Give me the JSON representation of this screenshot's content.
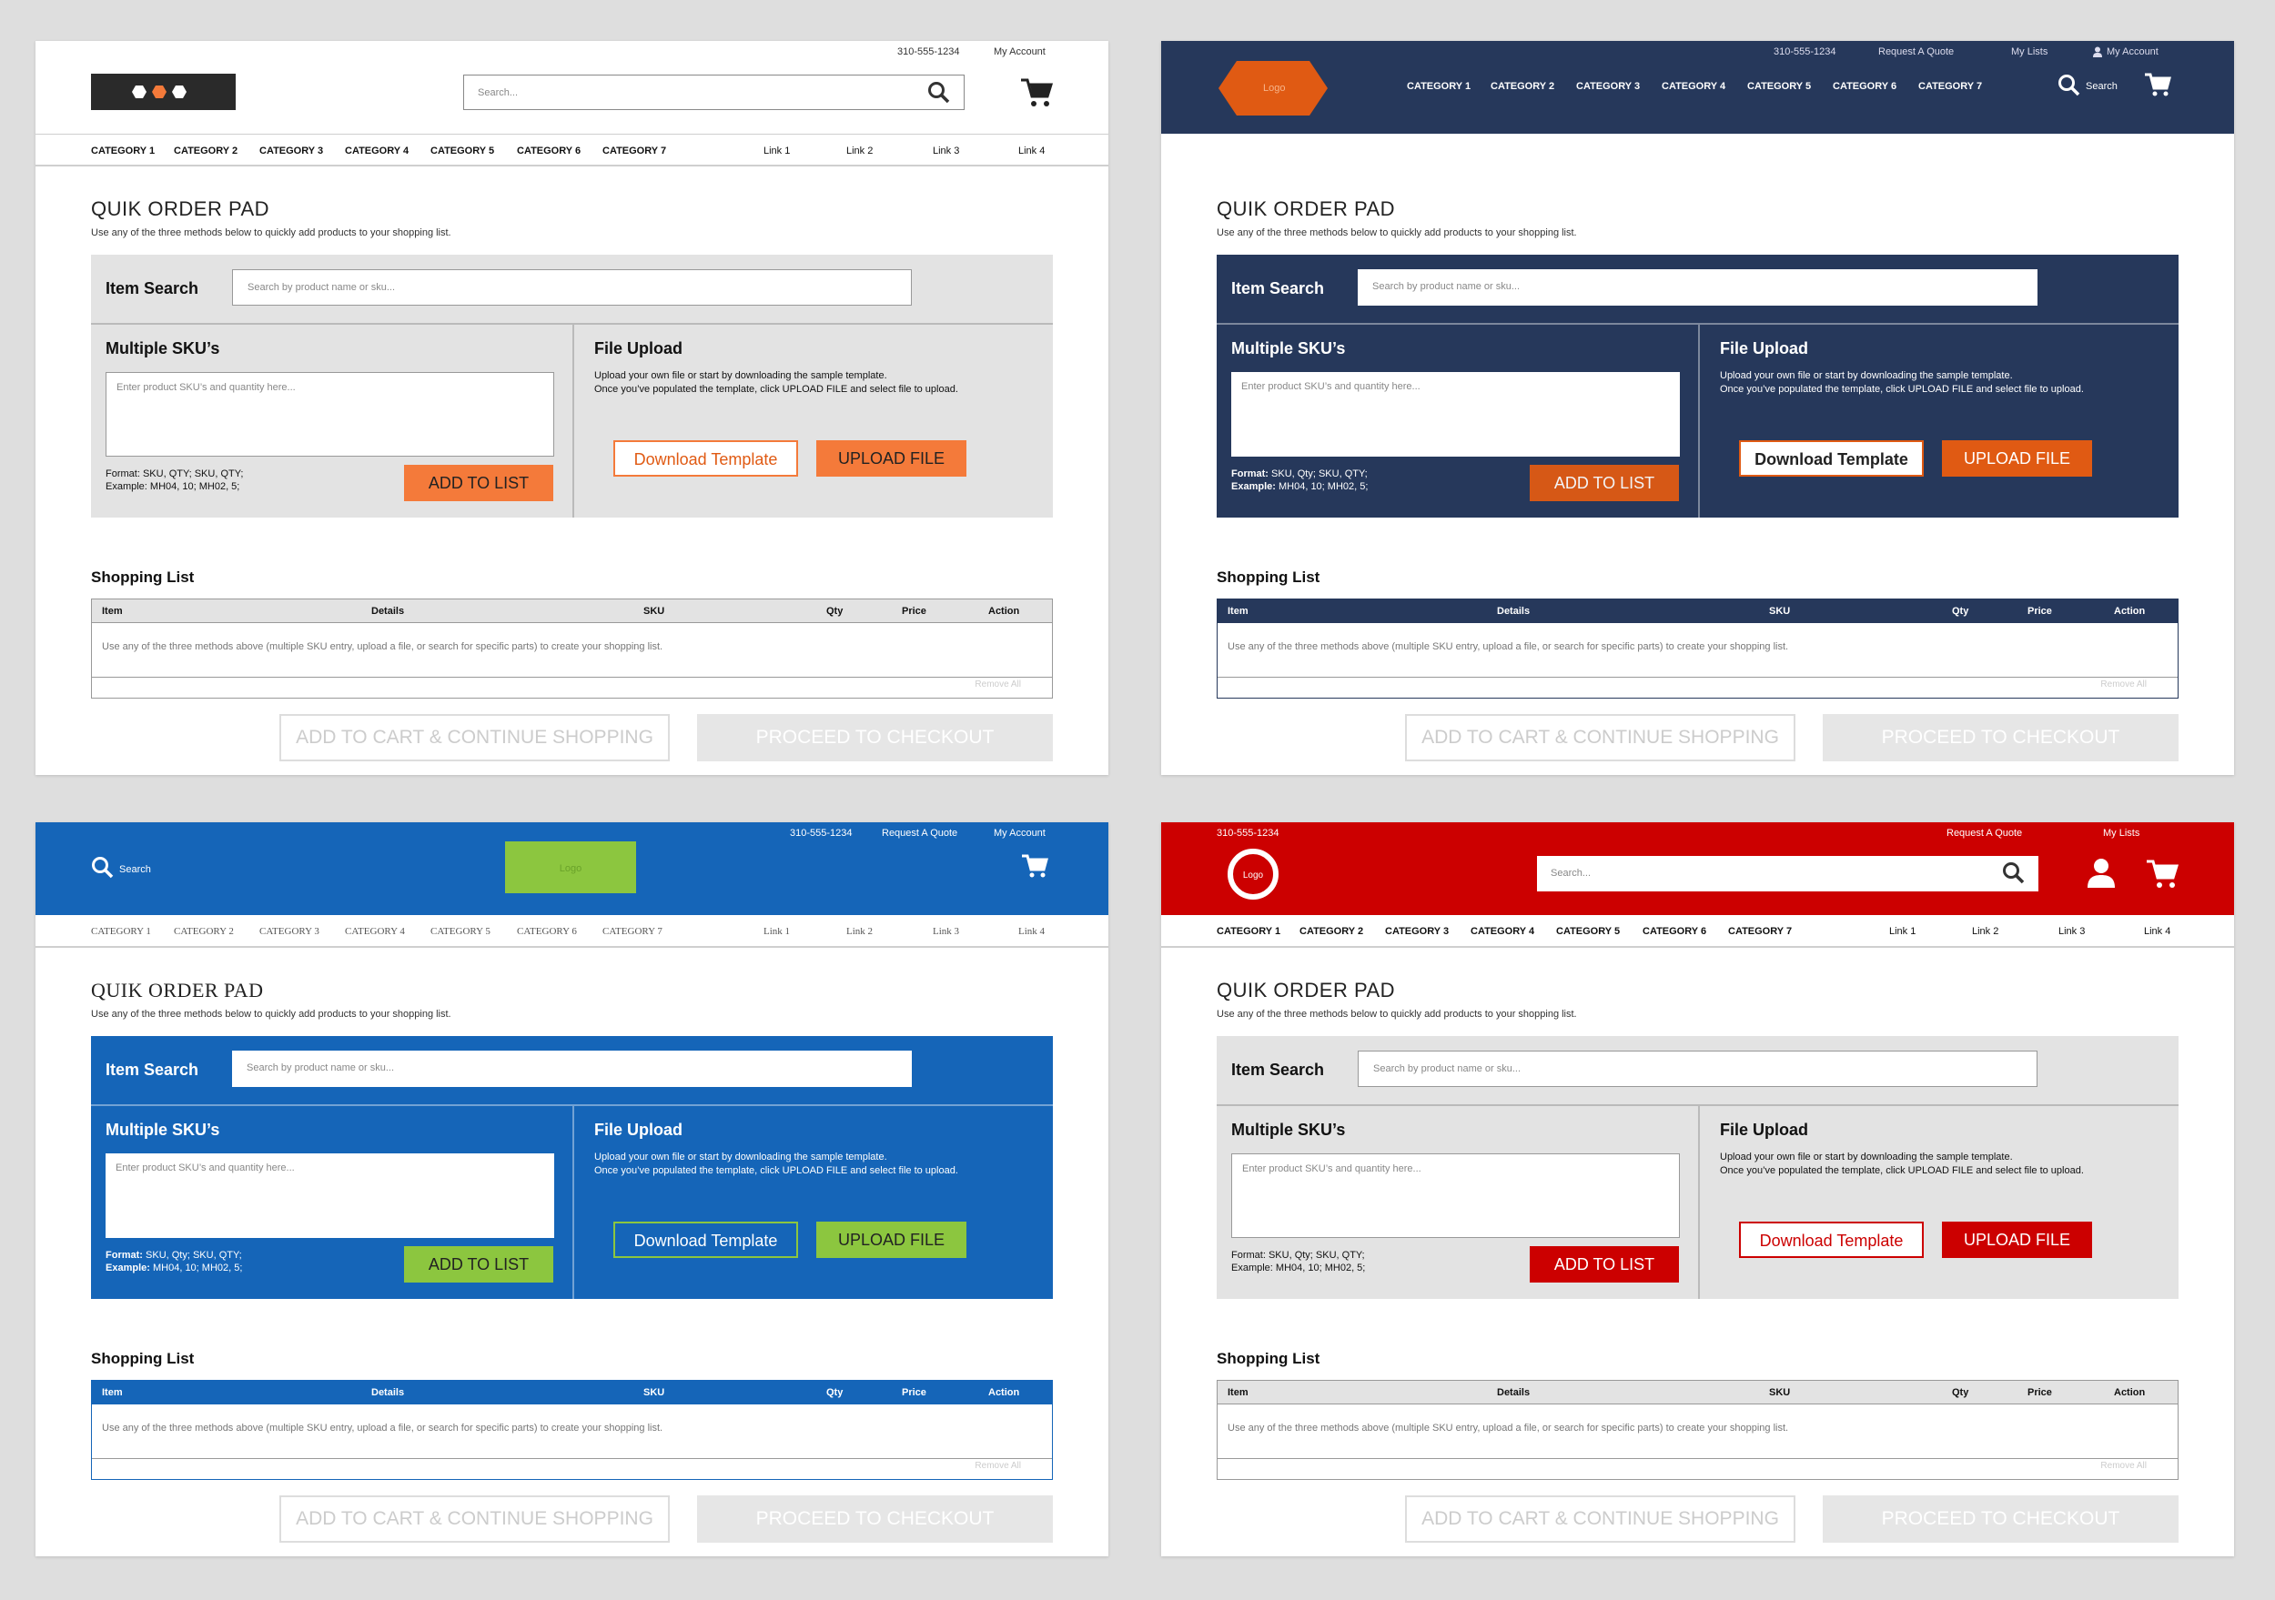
{
  "colors": {
    "background": "#dedede",
    "p1_orange": "#f47a3a",
    "p1_gray": "#e3e3e3",
    "p2_navy": "#26385b",
    "p2_orange": "#e05a13",
    "p3_blue": "#1565b8",
    "p3_green": "#8cc63f",
    "p4_red": "#cc0000"
  },
  "common": {
    "phone": "310-555-1234",
    "my_account": "My Account",
    "request_quote": "Request A Quote",
    "my_lists": "My Lists",
    "search": "Search",
    "search_dots": "Search...",
    "logo": "Logo",
    "categories": [
      "CATEGORY 1",
      "CATEGORY 2",
      "CATEGORY 3",
      "CATEGORY 4",
      "CATEGORY 5",
      "CATEGORY 6",
      "CATEGORY 7"
    ],
    "links": [
      "Link 1",
      "Link 2",
      "Link 3",
      "Link 4"
    ]
  },
  "page": {
    "title": "QUIK ORDER PAD",
    "subtitle": "Use any of the three methods below to quickly add products to your shopping list.",
    "item_search": {
      "label": "Item Search",
      "placeholder": "Search by product name or sku..."
    },
    "multiple_skus": {
      "label": "Multiple SKU’s",
      "placeholder": "Enter product SKU’s and quantity here...",
      "format_label": "Format:",
      "format_value_caps": "SKU, QTY; SKU, QTY;",
      "format_value_mixed": "SKU, Qty; SKU, QTY;",
      "example_label": "Example:",
      "example_value": "MH04, 10; MH02, 5;",
      "add_button": "ADD TO LIST"
    },
    "file_upload": {
      "label": "File Upload",
      "line1": "Upload your own file or start by downloading the sample template.",
      "line2": "Once you’ve populated the template, click UPLOAD FILE and select file to upload.",
      "download_button": "Download Template",
      "upload_button": "UPLOAD FILE"
    },
    "shopping_list": {
      "label": "Shopping List",
      "columns": [
        "Item",
        "Details",
        "SKU",
        "Qty",
        "Price",
        "Action"
      ],
      "empty_message": "Use any of the three methods above (multiple SKU entry, upload a file, or search for specific parts) to create your shopping list.",
      "remove_all": "Remove All"
    },
    "add_to_cart_button": "ADD TO CART & CONTINUE SHOPPING",
    "checkout_button": "PROCEED TO CHECKOUT"
  }
}
